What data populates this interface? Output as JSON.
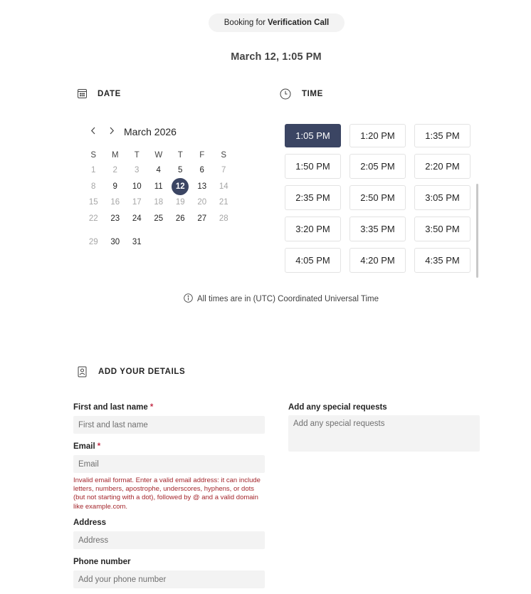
{
  "booking": {
    "prefix": "Booking for",
    "service": "Verification Call"
  },
  "selected_datetime": "March 12, 1:05 PM",
  "date_section": {
    "title": "DATE",
    "icon": "calendar-icon"
  },
  "time_section": {
    "title": "TIME",
    "icon": "clock-icon"
  },
  "calendar": {
    "month_label": "March 2026",
    "weekdays": [
      "S",
      "M",
      "T",
      "W",
      "T",
      "F",
      "S"
    ],
    "weeks": [
      [
        {
          "d": "1",
          "dim": true
        },
        {
          "d": "2",
          "dim": true
        },
        {
          "d": "3",
          "dim": true
        },
        {
          "d": "4"
        },
        {
          "d": "5"
        },
        {
          "d": "6"
        },
        {
          "d": "7",
          "dim": true
        }
      ],
      [
        {
          "d": "8",
          "dim": true
        },
        {
          "d": "9"
        },
        {
          "d": "10"
        },
        {
          "d": "11"
        },
        {
          "d": "12",
          "selected": true
        },
        {
          "d": "13"
        },
        {
          "d": "14",
          "dim": true
        }
      ],
      [
        {
          "d": "15",
          "dim": true
        },
        {
          "d": "16",
          "dim": true
        },
        {
          "d": "17",
          "dim": true
        },
        {
          "d": "18",
          "dim": true
        },
        {
          "d": "19",
          "dim": true
        },
        {
          "d": "20",
          "dim": true
        },
        {
          "d": "21",
          "dim": true
        }
      ],
      [
        {
          "d": "22",
          "dim": true
        },
        {
          "d": "23"
        },
        {
          "d": "24"
        },
        {
          "d": "25"
        },
        {
          "d": "26"
        },
        {
          "d": "27"
        },
        {
          "d": "28",
          "dim": true
        }
      ],
      [
        {
          "d": "29",
          "dim": true
        },
        {
          "d": "30"
        },
        {
          "d": "31"
        }
      ]
    ]
  },
  "time_slots": [
    "1:05 PM",
    "1:20 PM",
    "1:35 PM",
    "1:50 PM",
    "2:05 PM",
    "2:20 PM",
    "2:35 PM",
    "2:50 PM",
    "3:05 PM",
    "3:20 PM",
    "3:35 PM",
    "3:50 PM",
    "4:05 PM",
    "4:20 PM",
    "4:35 PM"
  ],
  "selected_slot": "1:05 PM",
  "timezone_note": "All times are in (UTC) Coordinated Universal Time",
  "details_section": {
    "title": "ADD YOUR DETAILS",
    "icon": "contact-card-icon"
  },
  "form": {
    "name": {
      "label": "First and last name",
      "required_mark": "*",
      "placeholder": "First and last name",
      "value": ""
    },
    "email": {
      "label": "Email",
      "required_mark": "*",
      "placeholder": "Email",
      "value": ""
    },
    "email_error": "Invalid email format. Enter a valid email address: it can include letters, numbers, apostrophe, underscores, hyphens, or dots (but not starting with a dot), followed by @ and a valid domain like example.com.",
    "address": {
      "label": "Address",
      "placeholder": "Address",
      "value": ""
    },
    "phone": {
      "label": "Phone number",
      "placeholder": "Add your phone number",
      "value": ""
    },
    "requests": {
      "label": "Add any special requests",
      "placeholder": "Add any special requests",
      "value": ""
    }
  },
  "colors": {
    "accent": "#3b4563",
    "error": "#a4262c",
    "required": "#c4314b",
    "input_bg": "#f3f3f3"
  }
}
